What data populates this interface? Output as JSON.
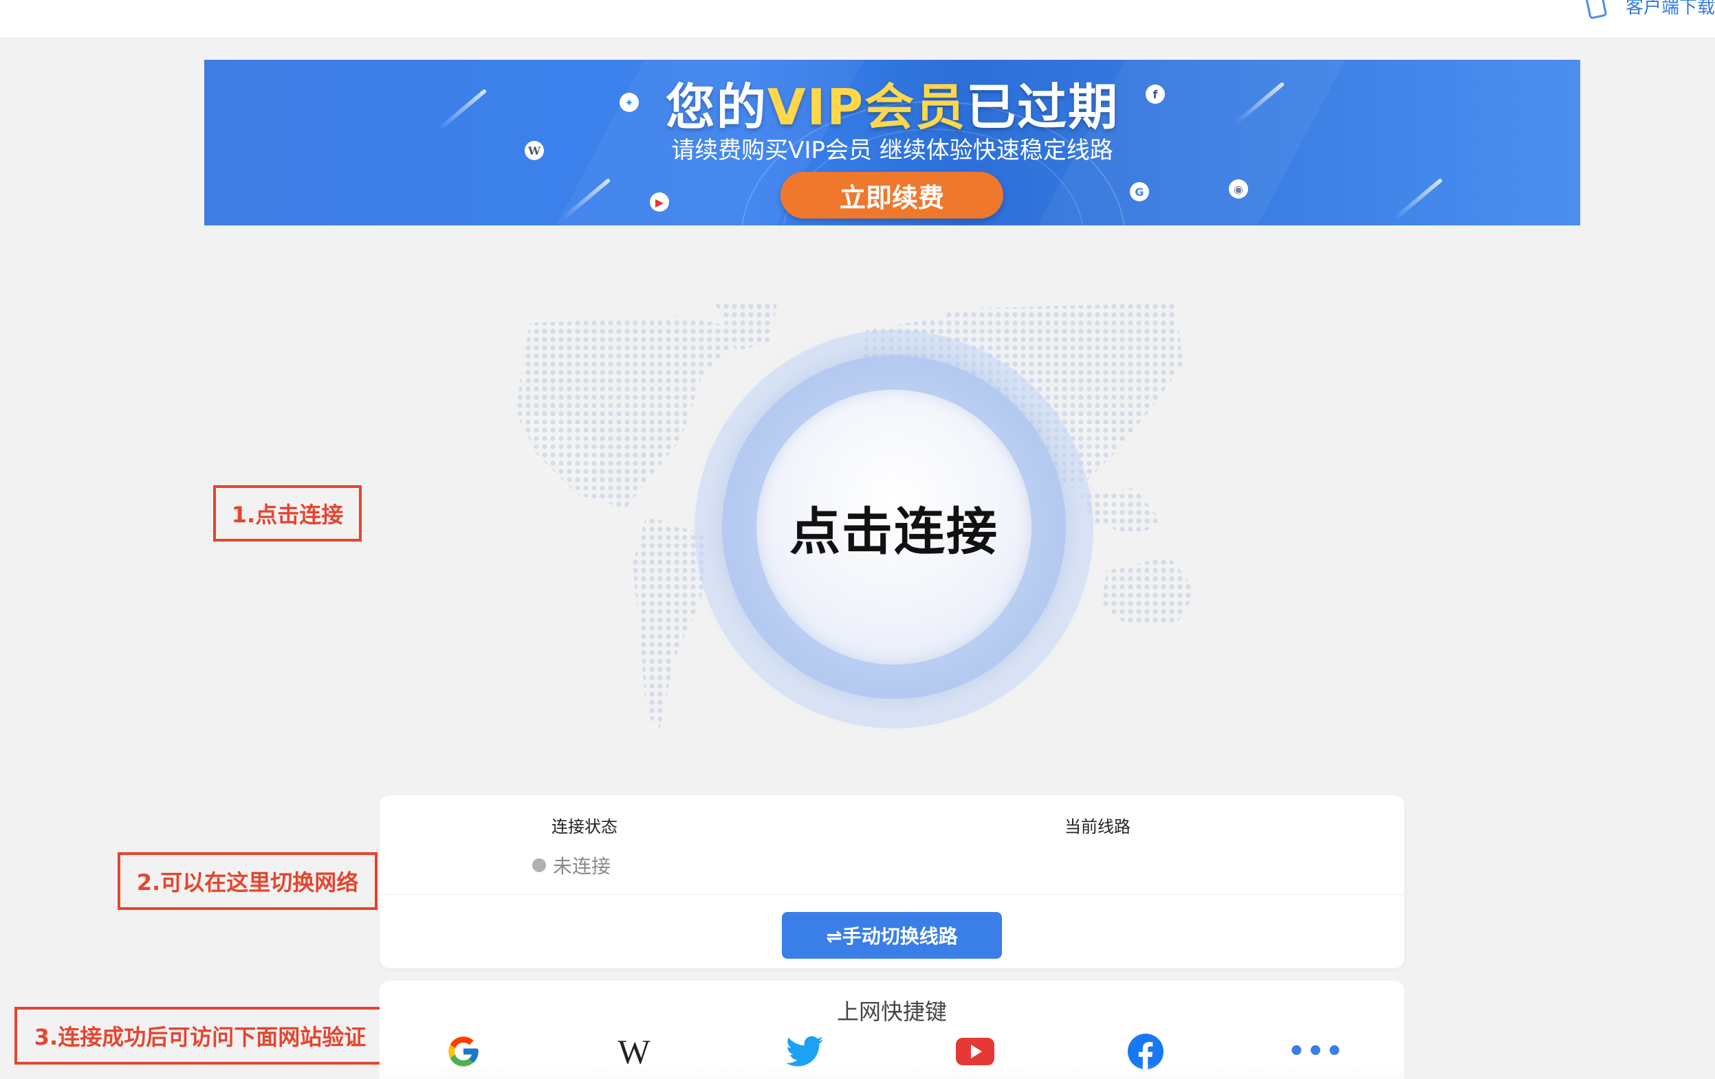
{
  "topbar": {
    "client_download": "客户端下载"
  },
  "banner": {
    "title_prefix": "您的",
    "title_vip": "VIP会员",
    "title_suffix": "已过期",
    "subtitle": "请续费购买VIP会员 继续体验快速稳定线路",
    "renew_button": "立即续费"
  },
  "connect": {
    "button_label": "点击连接"
  },
  "annotations": {
    "step1": "1.点击连接",
    "step2": "2.可以在这里切换网络",
    "step3": "3.连接成功后可访问下面网站验证"
  },
  "status_card": {
    "status_label": "连接状态",
    "status_value": "未连接",
    "line_label": "当前线路",
    "line_value": "",
    "switch_button": "⇌手动切换线路"
  },
  "shortcuts": {
    "title": "上网快捷键",
    "items": [
      "google",
      "wikipedia",
      "twitter",
      "youtube",
      "facebook",
      "more"
    ]
  },
  "colors": {
    "accent": "#3a7ee8",
    "renew": "#f0782c",
    "annotation": "#e5452f",
    "vip_gold": "#ffd84a"
  }
}
